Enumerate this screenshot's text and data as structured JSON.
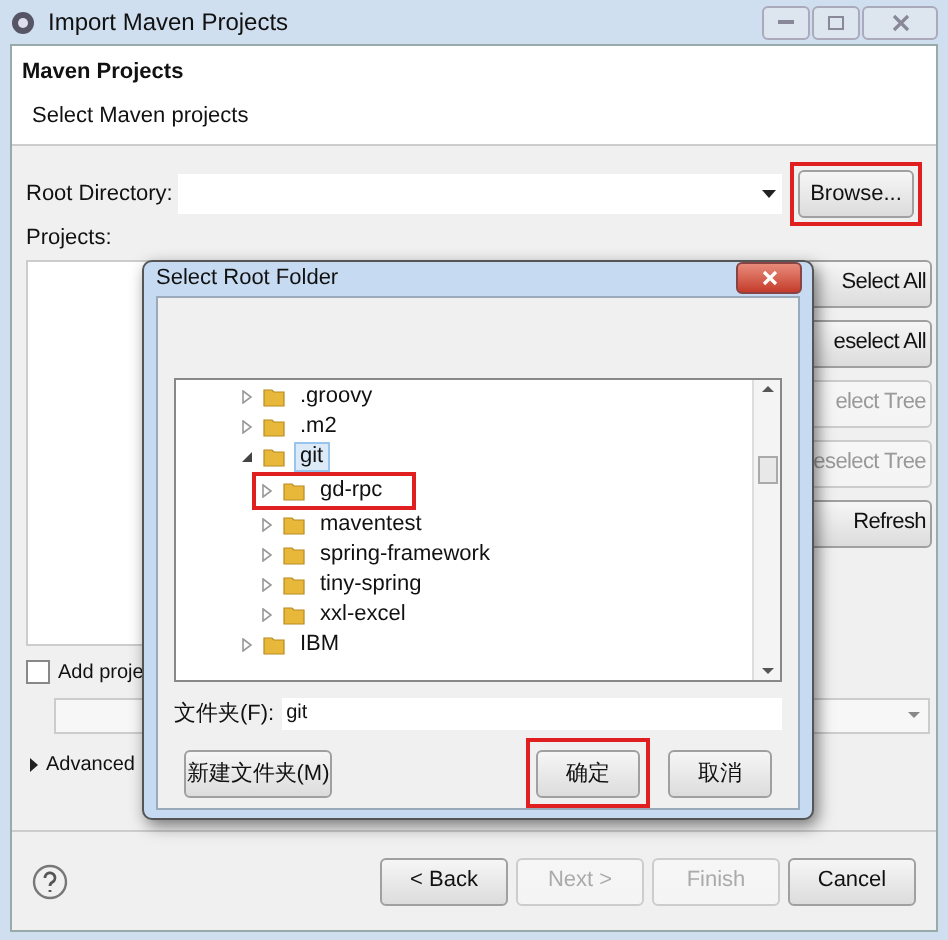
{
  "window": {
    "title": "Import Maven Projects"
  },
  "header": {
    "title": "Maven Projects",
    "description": "Select Maven projects"
  },
  "root_directory": {
    "label": "Root Directory:",
    "browse": {
      "label": "Browse...",
      "highlighted": true
    }
  },
  "projects": {
    "label": "Projects:"
  },
  "side_buttons": [
    {
      "label": "Select All",
      "disabled": false
    },
    {
      "label": "eselect All",
      "disabled": false
    },
    {
      "label": "elect Tree",
      "disabled": true
    },
    {
      "label": "eselect Tree",
      "disabled": true
    },
    {
      "label": "Refresh",
      "disabled": false
    }
  ],
  "add_to_working_set": {
    "label": "Add proje",
    "checked": false
  },
  "advanced": {
    "label": "Advanced",
    "expanded": false
  },
  "footer_buttons": [
    {
      "label": "< Back",
      "disabled": false
    },
    {
      "label": "Next >",
      "disabled": true
    },
    {
      "label": "Finish",
      "disabled": true
    },
    {
      "label": "Cancel",
      "disabled": false
    }
  ],
  "dialog": {
    "title": "Select Root Folder",
    "tree": [
      {
        "name": ".groovy",
        "expanded": false,
        "selected": false,
        "highlighted": false
      },
      {
        "name": ".m2",
        "expanded": false,
        "selected": false,
        "highlighted": false
      },
      {
        "name": "git",
        "expanded": true,
        "selected": true,
        "highlighted": false,
        "children": [
          {
            "name": "gd-rpc",
            "expanded": false,
            "selected": false,
            "highlighted": true
          },
          {
            "name": "maventest",
            "expanded": false,
            "selected": false,
            "highlighted": false
          },
          {
            "name": "spring-framework",
            "expanded": false,
            "selected": false,
            "highlighted": false
          },
          {
            "name": "tiny-spring",
            "expanded": false,
            "selected": false,
            "highlighted": false
          },
          {
            "name": "xxl-excel",
            "expanded": false,
            "selected": false,
            "highlighted": false
          }
        ]
      },
      {
        "name": "IBM",
        "expanded": false,
        "selected": false,
        "highlighted": false
      }
    ],
    "folder": {
      "label": "文件夹(F):",
      "value": "git"
    },
    "buttons": [
      {
        "label": "新建文件夹(M)",
        "highlighted": false
      },
      {
        "label": "确定",
        "highlighted": true
      },
      {
        "label": "取消",
        "highlighted": false
      }
    ]
  }
}
